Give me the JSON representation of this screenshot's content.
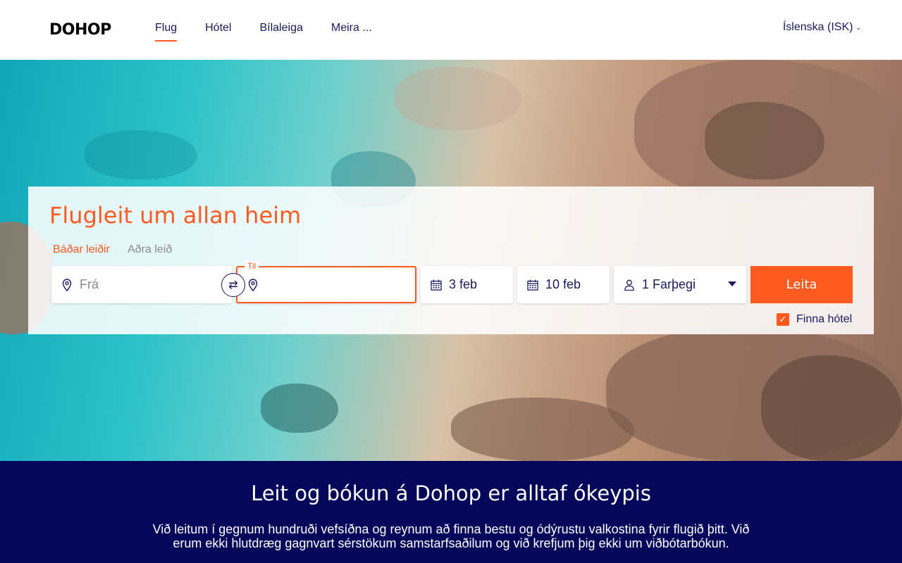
{
  "header": {
    "logo": "DOHOP",
    "nav": [
      {
        "label": "Flug",
        "active": true
      },
      {
        "label": "Hótel",
        "active": false
      },
      {
        "label": "Bílaleiga",
        "active": false
      },
      {
        "label": "Meira ...",
        "active": false
      }
    ],
    "language": "Íslenska (ISK)"
  },
  "search": {
    "title": "Flugleit um allan heim",
    "trip_tabs": [
      "Báðar leiðir",
      "Aðra leið"
    ],
    "from_placeholder": "Frá",
    "to_label": "Til",
    "to_value": "",
    "departure_date": "3 feb",
    "return_date": "10 feb",
    "passengers": "1 Farþegi",
    "search_button": "Leita",
    "find_hotel_label": "Finna hótel",
    "find_hotel_checked": true
  },
  "info": {
    "title": "Leit og bókun á Dohop er alltaf ókeypis",
    "text": "Við leitum í gegnum hundruði vefsíðna og reynum að finna bestu og ódýrustu valkostina fyrir flugið þitt. Við erum ekki hlutdræg gagnvart sérstökum samstarfsaðilum og við krefjum þig ekki um viðbótarbókun."
  },
  "colors": {
    "accent": "#ff5a1f",
    "navy": "#04065a",
    "text_dark": "#1a1a5e"
  }
}
